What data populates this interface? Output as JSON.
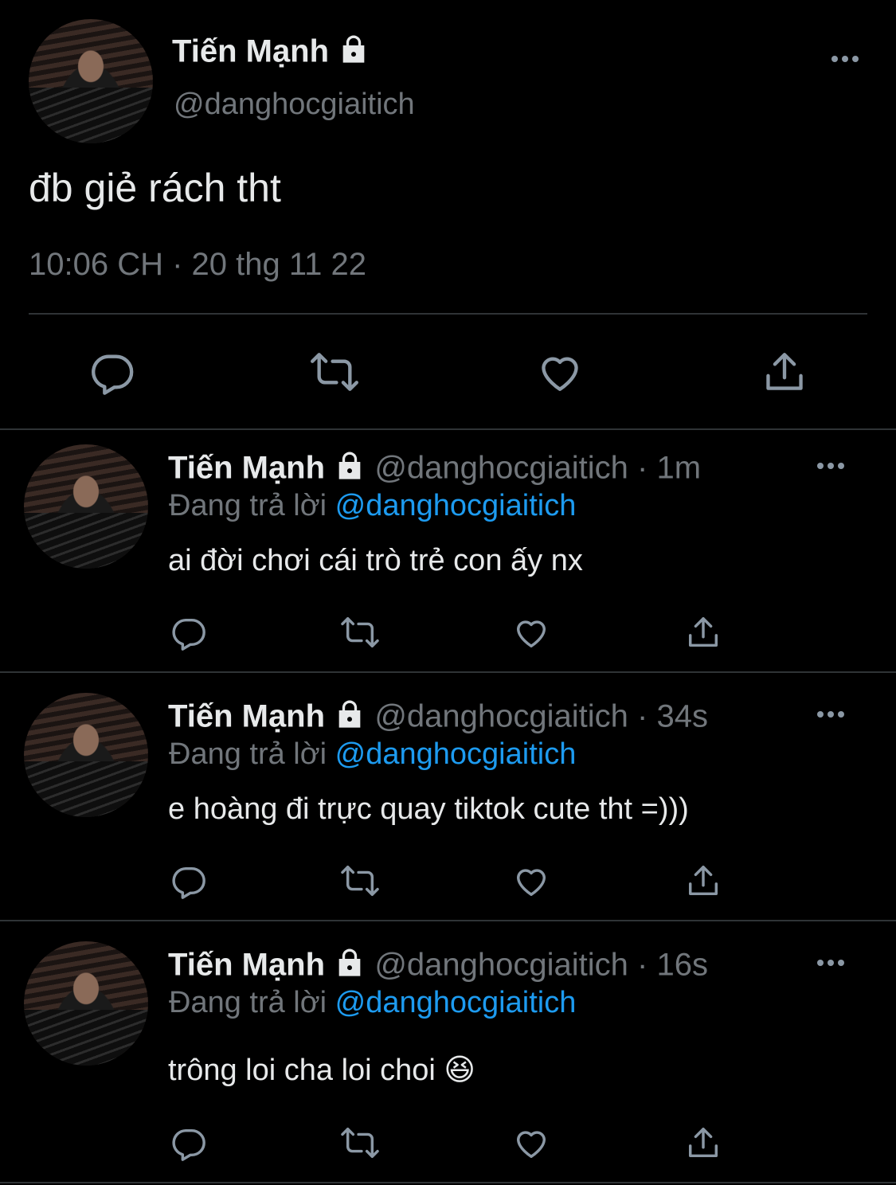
{
  "main_tweet": {
    "display_name": "Tiến Mạnh",
    "handle": "@danghocgiaitich",
    "text": "đb giẻ rách tht",
    "timestamp": "10:06 CH · 20 thg 11 22"
  },
  "replies": [
    {
      "display_name": "Tiến Mạnh",
      "handle_time": "@danghocgiaitich · 1m",
      "replying_prefix": "Đang trả lời",
      "replying_to": "@danghocgiaitich",
      "text": "ai đời chơi cái trò trẻ con ấy nx"
    },
    {
      "display_name": "Tiến Mạnh",
      "handle_time": "@danghocgiaitich · 34s",
      "replying_prefix": "Đang trả lời",
      "replying_to": "@danghocgiaitich",
      "text": "e hoàng đi trực quay tiktok cute tht =)))"
    },
    {
      "display_name": "Tiến Mạnh",
      "handle_time": "@danghocgiaitich · 16s",
      "replying_prefix": "Đang trả lời",
      "replying_to": "@danghocgiaitich",
      "text": "trông loi cha loi choi 😆"
    }
  ],
  "icons": {
    "reply": "reply-icon",
    "retweet": "retweet-icon",
    "like": "heart-icon",
    "share": "share-icon",
    "more": "more-icon",
    "lock": "lock-icon"
  },
  "colors": {
    "background": "#000000",
    "text": "#e7e9ea",
    "muted": "#71767b",
    "link": "#1d9bf0",
    "divider": "#2f3336"
  }
}
